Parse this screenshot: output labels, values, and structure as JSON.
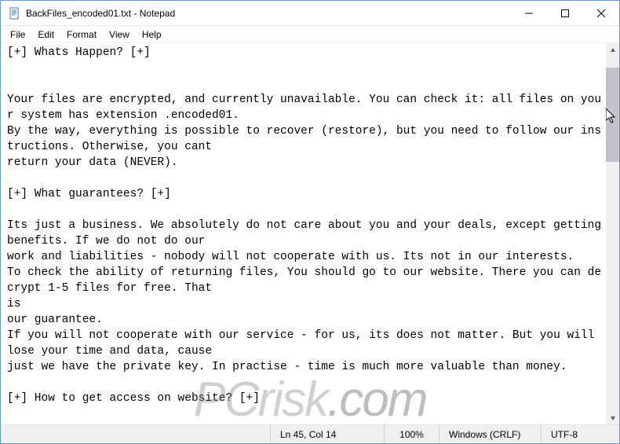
{
  "window": {
    "title": "BackFiles_encoded01.txt - Notepad"
  },
  "menu": {
    "file": "File",
    "edit": "Edit",
    "format": "Format",
    "view": "View",
    "help": "Help"
  },
  "document": {
    "text": "[+] Whats Happen? [+]\n\n\nYour files are encrypted, and currently unavailable. You can check it: all files on your system has extension .encoded01.\nBy the way, everything is possible to recover (restore), but you need to follow our instructions. Otherwise, you cant\nreturn your data (NEVER).\n\n[+] What guarantees? [+]\n\nIts just a business. We absolutely do not care about you and your deals, except getting benefits. If we do not do our\nwork and liabilities - nobody will not cooperate with us. Its not in our interests.\nTo check the ability of returning files, You should go to our website. There you can decrypt 1-5 files for free. That\nis\nour guarantee.\nIf you will not cooperate with our service - for us, its does not matter. But you will lose your time and data, cause\njust we have the private key. In practise - time is much more valuable than money.\n\n[+] How to get access on website? [+]"
  },
  "statusbar": {
    "position": "Ln 45, Col 14",
    "zoom": "100%",
    "eol": "Windows (CRLF)",
    "encoding": "UTF-8"
  },
  "icons": {
    "notepad": "notepad-icon",
    "minimize": "minimize-icon",
    "maximize": "maximize-icon",
    "close": "close-icon",
    "up": "chevron-up-icon",
    "down": "chevron-down-icon"
  },
  "watermark": {
    "text1": "PCrisk",
    "text2": ".com"
  }
}
